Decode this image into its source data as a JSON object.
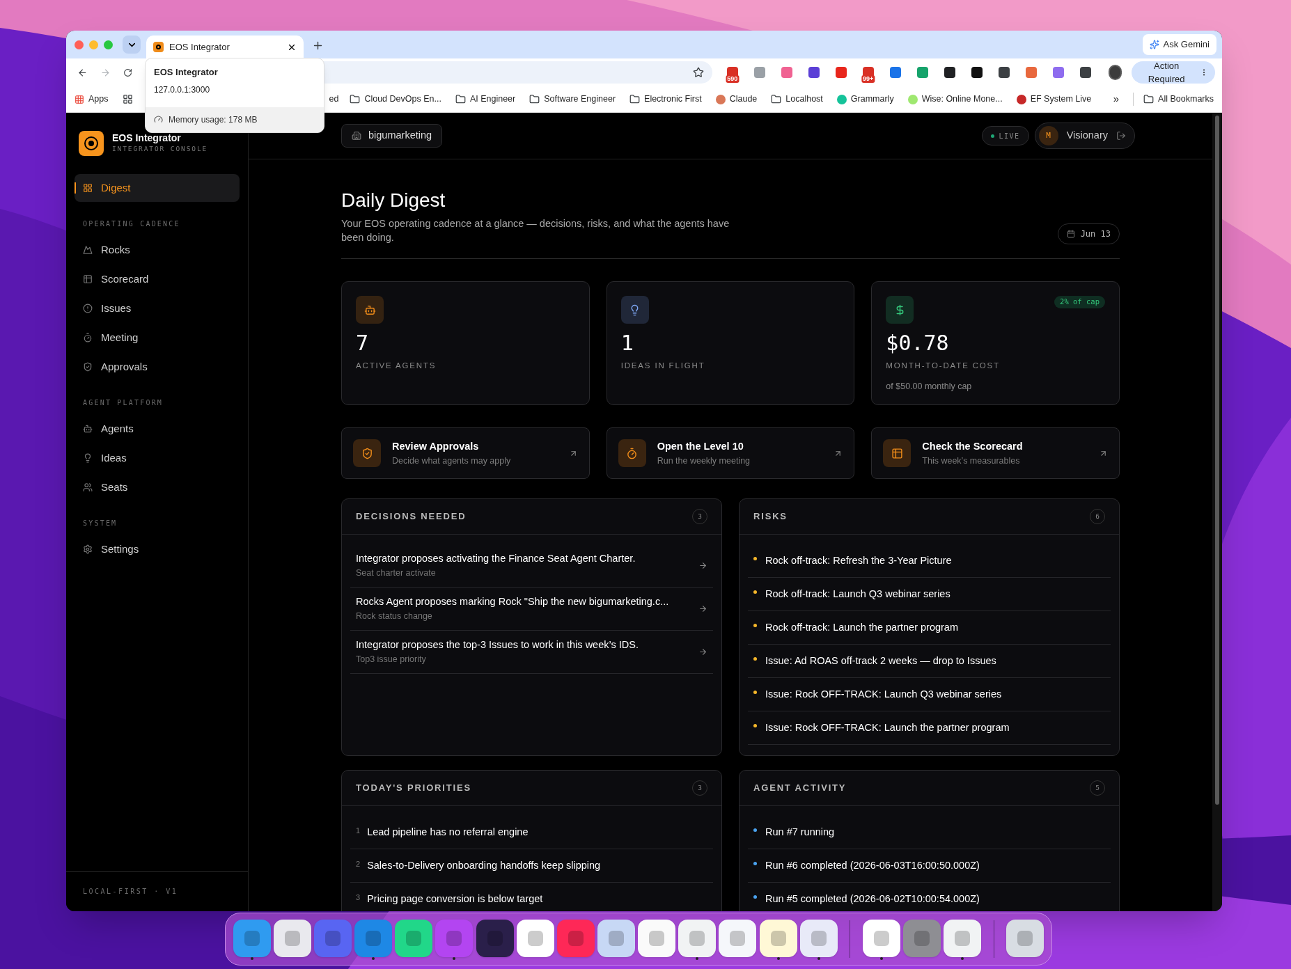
{
  "browser": {
    "tab": {
      "title": "EOS Integrator",
      "selected": true
    },
    "tooltip": {
      "title": "EOS Integrator",
      "url": "127.0.0.1:3000",
      "memory": "Memory usage: 178 MB"
    },
    "ask_button": "Ask Gemini",
    "extensions": [
      {
        "color": "#d93025",
        "badge": "590"
      },
      {
        "color": "#9aa0a6"
      },
      {
        "color": "#f06292"
      },
      {
        "color": "#5b3fd6"
      },
      {
        "color": "#e8261c"
      },
      {
        "color": "#d93025",
        "badge": "99+"
      },
      {
        "color": "#1a73e8"
      },
      {
        "color": "#16a36b"
      },
      {
        "color": "#202124"
      },
      {
        "color": "#111111"
      },
      {
        "color": "#3c4043"
      },
      {
        "color": "#e8683d"
      },
      {
        "color": "#8e6cef"
      },
      {
        "color": "#3c4043"
      }
    ],
    "action_button": "Action Required",
    "bookmarks": [
      {
        "label": "Apps",
        "kind": "apps"
      },
      {
        "label": "ed",
        "kind": "text"
      },
      {
        "label": "Cloud DevOps En...",
        "kind": "folder"
      },
      {
        "label": "AI Engineer",
        "kind": "folder"
      },
      {
        "label": "Software Engineer",
        "kind": "folder"
      },
      {
        "label": "Electronic First",
        "kind": "folder"
      },
      {
        "label": "Claude",
        "kind": "site",
        "color": "#d97757"
      },
      {
        "label": "Localhost",
        "kind": "folder"
      },
      {
        "label": "Grammarly",
        "kind": "site",
        "color": "#15c39a"
      },
      {
        "label": "Wise: Online Mone...",
        "kind": "site",
        "color": "#9fe870"
      },
      {
        "label": "EF System Live",
        "kind": "site",
        "color": "#c62828"
      }
    ],
    "more": "»",
    "all_bookmarks": "All Bookmarks"
  },
  "sidebar": {
    "brand": {
      "title": "EOS Integrator",
      "subtitle": "INTEGRATOR CONSOLE"
    },
    "sections": [
      {
        "items": [
          {
            "label": "Digest",
            "selected": true
          }
        ]
      },
      {
        "heading": "OPERATING CADENCE",
        "items": [
          {
            "label": "Rocks",
            "selected": false
          },
          {
            "label": "Scorecard",
            "selected": false
          },
          {
            "label": "Issues",
            "selected": false
          },
          {
            "label": "Meeting",
            "selected": false
          },
          {
            "label": "Approvals",
            "selected": false
          }
        ]
      },
      {
        "heading": "AGENT PLATFORM",
        "items": [
          {
            "label": "Agents",
            "selected": false
          },
          {
            "label": "Ideas",
            "selected": false
          },
          {
            "label": "Seats",
            "selected": false
          }
        ]
      },
      {
        "heading": "SYSTEM",
        "items": [
          {
            "label": "Settings",
            "selected": false
          }
        ]
      }
    ],
    "footer": "LOCAL-FIRST · V1"
  },
  "topbar": {
    "workspace": "bigumarketing",
    "status": "LIVE",
    "user": {
      "initial": "M",
      "role": "Visionary"
    }
  },
  "page": {
    "title": "Daily Digest",
    "subtitle": "Your EOS operating cadence at a glance — decisions, risks, and what the agents have been doing.",
    "date": "Jun 13"
  },
  "stats": [
    {
      "value": "7",
      "label": "ACTIVE AGENTS",
      "color": "#f08c1a"
    },
    {
      "value": "1",
      "label": "IDEAS IN FLIGHT",
      "color": "#7fa8f5"
    },
    {
      "value": "$0.78",
      "label": "MONTH-TO-DATE COST",
      "color": "#34c77b",
      "badge": "2% of cap",
      "note": "of $50.00 monthly cap"
    }
  ],
  "quick_links": [
    {
      "title": "Review Approvals",
      "subtitle": "Decide what agents may apply"
    },
    {
      "title": "Open the Level 10",
      "subtitle": "Run the weekly meeting"
    },
    {
      "title": "Check the Scorecard",
      "subtitle": "This week’s measurables"
    }
  ],
  "panels": [
    {
      "kind": "decisions",
      "title": "DECISIONS NEEDED",
      "count": "3",
      "items": [
        {
          "text": "Integrator proposes activating the Finance Seat Agent Charter.",
          "subtitle": "Seat charter activate"
        },
        {
          "text": "Rocks Agent proposes marking Rock \"Ship the new bigumarketing.c...",
          "subtitle": "Rock status change"
        },
        {
          "text": "Integrator proposes the top-3 Issues to work in this week’s IDS.",
          "subtitle": "Top3 issue priority"
        }
      ]
    },
    {
      "kind": "dots",
      "title": "RISKS",
      "count": "6",
      "items": [
        {
          "text": "Rock off-track: Refresh the 3-Year Picture",
          "color": "#f5b72a"
        },
        {
          "text": "Rock off-track: Launch Q3 webinar series",
          "color": "#f5b72a"
        },
        {
          "text": "Rock off-track: Launch the partner program",
          "color": "#f5b72a"
        },
        {
          "text": "Issue: Ad ROAS off-track 2 weeks — drop to Issues",
          "color": "#f5b72a"
        },
        {
          "text": "Issue: Rock OFF-TRACK: Launch Q3 webinar series",
          "color": "#f5b72a"
        },
        {
          "text": "Issue: Rock OFF-TRACK: Launch the partner program",
          "color": "#f5b72a"
        }
      ]
    },
    {
      "kind": "numbered",
      "title": "TODAY'S PRIORITIES",
      "count": "3",
      "items": [
        {
          "number": "1",
          "text": "Lead pipeline has no referral engine"
        },
        {
          "number": "2",
          "text": "Sales-to-Delivery onboarding handoffs keep slipping"
        },
        {
          "number": "3",
          "text": "Pricing page conversion is below target"
        }
      ]
    },
    {
      "kind": "dots",
      "title": "AGENT ACTIVITY",
      "count": "5",
      "items": [
        {
          "text": "Run #7 running",
          "color": "#4aa3f0"
        },
        {
          "text": "Run #6 completed (2026-06-03T16:00:50.000Z)",
          "color": "#4aa3f0"
        },
        {
          "text": "Run #5 completed (2026-06-02T10:00:54.000Z)",
          "color": "#4aa3f0"
        }
      ]
    }
  ],
  "dock": [
    {
      "color": "#2f9bf0",
      "running": true
    },
    {
      "color": "#e9e9ee",
      "running": false
    },
    {
      "color": "#5865f2",
      "running": false
    },
    {
      "color": "#1e88e5",
      "running": true
    },
    {
      "color": "#21d789",
      "running": false
    },
    {
      "color": "#b345f1",
      "running": true
    },
    {
      "color": "#2a1f4a",
      "running": false
    },
    {
      "color": "#ffffff",
      "running": false
    },
    {
      "color": "#fe2857",
      "running": false
    },
    {
      "color": "#c7d8f5",
      "running": false
    },
    {
      "color": "#fafafa",
      "running": false
    },
    {
      "color": "#f1f3f4",
      "running": true
    },
    {
      "color": "#f5f7fb",
      "running": false
    },
    {
      "color": "#fff8d6",
      "running": true
    },
    {
      "color": "#e8eaf8",
      "running": true
    },
    {
      "sep": true
    },
    {
      "color": "#ffffff",
      "running": true
    },
    {
      "color": "#8e8e93",
      "running": false
    },
    {
      "color": "#f1f3f4",
      "running": true
    },
    {
      "sep": true
    },
    {
      "color": "#d8dde3",
      "running": false
    }
  ]
}
